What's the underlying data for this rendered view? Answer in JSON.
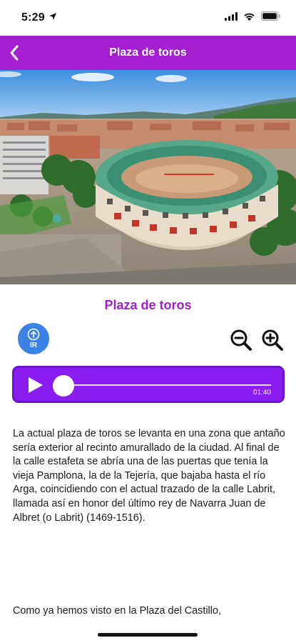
{
  "status_bar": {
    "time": "5:29",
    "icons": [
      "location-arrow-icon",
      "cellular-signal-icon",
      "wifi-icon",
      "battery-icon"
    ]
  },
  "app_bar": {
    "title": "Plaza de toros",
    "back_icon": "chevron-left-icon",
    "background_color": "#a31fcf"
  },
  "hero_image": {
    "subject": "aerial-photo-bullring"
  },
  "content": {
    "section_title": "Plaza de toros",
    "title_color": "#a020d0",
    "ir_button_label": "IR",
    "ir_icon": "arrow-up-circle-icon",
    "zoom_out_icon": "zoom-out-icon",
    "zoom_in_icon": "zoom-in-icon"
  },
  "player": {
    "play_icon": "play-icon",
    "duration": "01:40",
    "progress": 0.0,
    "color": "#8a1df0"
  },
  "paragraphs": [
    "La actual plaza de toros se levanta en una zona que antaño sería exterior al recinto amurallado de la ciudad. Al final de la calle estafeta se abría una de las puertas que tenía la vieja Pamplona, la de la Tejería, que bajaba hasta el río Arga, coincidiendo con el actual trazado de la calle Labrit, llamada así en honor del último rey de Navarra Juan de Albret (o Labrit) (1469-1516).",
    "Como ya hemos visto en la Plaza del Castillo,"
  ]
}
